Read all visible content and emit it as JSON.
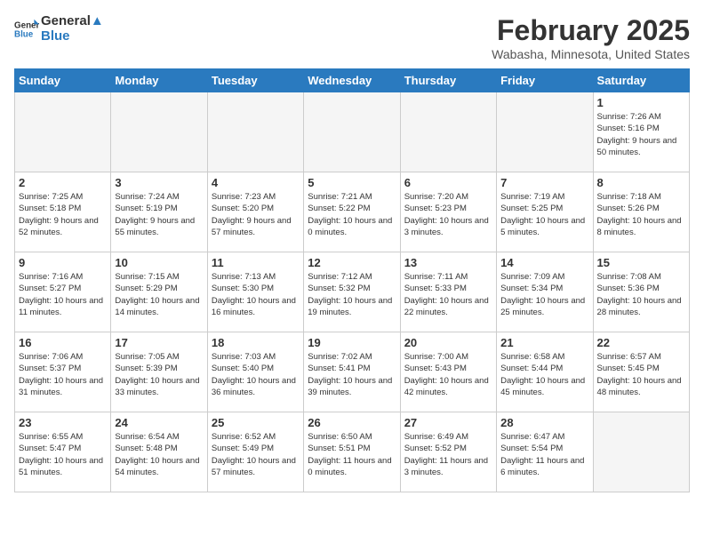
{
  "header": {
    "logo_line1": "General",
    "logo_line2": "Blue",
    "main_title": "February 2025",
    "subtitle": "Wabasha, Minnesota, United States"
  },
  "days_of_week": [
    "Sunday",
    "Monday",
    "Tuesday",
    "Wednesday",
    "Thursday",
    "Friday",
    "Saturday"
  ],
  "weeks": [
    [
      {
        "day": "",
        "info": ""
      },
      {
        "day": "",
        "info": ""
      },
      {
        "day": "",
        "info": ""
      },
      {
        "day": "",
        "info": ""
      },
      {
        "day": "",
        "info": ""
      },
      {
        "day": "",
        "info": ""
      },
      {
        "day": "1",
        "info": "Sunrise: 7:26 AM\nSunset: 5:16 PM\nDaylight: 9 hours and 50 minutes."
      }
    ],
    [
      {
        "day": "2",
        "info": "Sunrise: 7:25 AM\nSunset: 5:18 PM\nDaylight: 9 hours and 52 minutes."
      },
      {
        "day": "3",
        "info": "Sunrise: 7:24 AM\nSunset: 5:19 PM\nDaylight: 9 hours and 55 minutes."
      },
      {
        "day": "4",
        "info": "Sunrise: 7:23 AM\nSunset: 5:20 PM\nDaylight: 9 hours and 57 minutes."
      },
      {
        "day": "5",
        "info": "Sunrise: 7:21 AM\nSunset: 5:22 PM\nDaylight: 10 hours and 0 minutes."
      },
      {
        "day": "6",
        "info": "Sunrise: 7:20 AM\nSunset: 5:23 PM\nDaylight: 10 hours and 3 minutes."
      },
      {
        "day": "7",
        "info": "Sunrise: 7:19 AM\nSunset: 5:25 PM\nDaylight: 10 hours and 5 minutes."
      },
      {
        "day": "8",
        "info": "Sunrise: 7:18 AM\nSunset: 5:26 PM\nDaylight: 10 hours and 8 minutes."
      }
    ],
    [
      {
        "day": "9",
        "info": "Sunrise: 7:16 AM\nSunset: 5:27 PM\nDaylight: 10 hours and 11 minutes."
      },
      {
        "day": "10",
        "info": "Sunrise: 7:15 AM\nSunset: 5:29 PM\nDaylight: 10 hours and 14 minutes."
      },
      {
        "day": "11",
        "info": "Sunrise: 7:13 AM\nSunset: 5:30 PM\nDaylight: 10 hours and 16 minutes."
      },
      {
        "day": "12",
        "info": "Sunrise: 7:12 AM\nSunset: 5:32 PM\nDaylight: 10 hours and 19 minutes."
      },
      {
        "day": "13",
        "info": "Sunrise: 7:11 AM\nSunset: 5:33 PM\nDaylight: 10 hours and 22 minutes."
      },
      {
        "day": "14",
        "info": "Sunrise: 7:09 AM\nSunset: 5:34 PM\nDaylight: 10 hours and 25 minutes."
      },
      {
        "day": "15",
        "info": "Sunrise: 7:08 AM\nSunset: 5:36 PM\nDaylight: 10 hours and 28 minutes."
      }
    ],
    [
      {
        "day": "16",
        "info": "Sunrise: 7:06 AM\nSunset: 5:37 PM\nDaylight: 10 hours and 31 minutes."
      },
      {
        "day": "17",
        "info": "Sunrise: 7:05 AM\nSunset: 5:39 PM\nDaylight: 10 hours and 33 minutes."
      },
      {
        "day": "18",
        "info": "Sunrise: 7:03 AM\nSunset: 5:40 PM\nDaylight: 10 hours and 36 minutes."
      },
      {
        "day": "19",
        "info": "Sunrise: 7:02 AM\nSunset: 5:41 PM\nDaylight: 10 hours and 39 minutes."
      },
      {
        "day": "20",
        "info": "Sunrise: 7:00 AM\nSunset: 5:43 PM\nDaylight: 10 hours and 42 minutes."
      },
      {
        "day": "21",
        "info": "Sunrise: 6:58 AM\nSunset: 5:44 PM\nDaylight: 10 hours and 45 minutes."
      },
      {
        "day": "22",
        "info": "Sunrise: 6:57 AM\nSunset: 5:45 PM\nDaylight: 10 hours and 48 minutes."
      }
    ],
    [
      {
        "day": "23",
        "info": "Sunrise: 6:55 AM\nSunset: 5:47 PM\nDaylight: 10 hours and 51 minutes."
      },
      {
        "day": "24",
        "info": "Sunrise: 6:54 AM\nSunset: 5:48 PM\nDaylight: 10 hours and 54 minutes."
      },
      {
        "day": "25",
        "info": "Sunrise: 6:52 AM\nSunset: 5:49 PM\nDaylight: 10 hours and 57 minutes."
      },
      {
        "day": "26",
        "info": "Sunrise: 6:50 AM\nSunset: 5:51 PM\nDaylight: 11 hours and 0 minutes."
      },
      {
        "day": "27",
        "info": "Sunrise: 6:49 AM\nSunset: 5:52 PM\nDaylight: 11 hours and 3 minutes."
      },
      {
        "day": "28",
        "info": "Sunrise: 6:47 AM\nSunset: 5:54 PM\nDaylight: 11 hours and 6 minutes."
      },
      {
        "day": "",
        "info": ""
      }
    ]
  ]
}
